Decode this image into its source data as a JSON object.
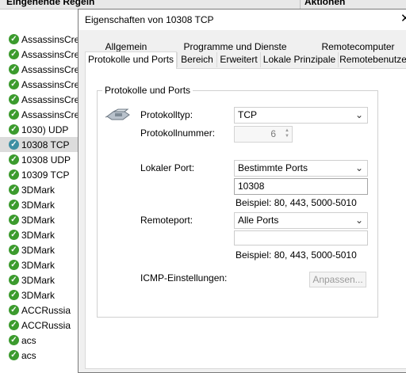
{
  "background": {
    "left_title": "Eingehende Regeln",
    "right_title": "Aktionen",
    "rules": [
      {
        "label": "AssassinsCre",
        "style": "green"
      },
      {
        "label": "AssassinsCre",
        "style": "green"
      },
      {
        "label": "AssassinsCre",
        "style": "green"
      },
      {
        "label": "AssassinsCre",
        "style": "green"
      },
      {
        "label": "AssassinsCre",
        "style": "green"
      },
      {
        "label": "AssassinsCre",
        "style": "green"
      },
      {
        "label": "1030) UDP",
        "style": "green"
      },
      {
        "label": "10308 TCP",
        "style": "alt",
        "selected": true
      },
      {
        "label": "10308 UDP",
        "style": "green"
      },
      {
        "label": "10309 TCP",
        "style": "green"
      },
      {
        "label": "3DMark",
        "style": "green"
      },
      {
        "label": "3DMark",
        "style": "green"
      },
      {
        "label": "3DMark",
        "style": "green"
      },
      {
        "label": "3DMark",
        "style": "green"
      },
      {
        "label": "3DMark",
        "style": "green"
      },
      {
        "label": "3DMark",
        "style": "green"
      },
      {
        "label": "3DMark",
        "style": "green"
      },
      {
        "label": "3DMark",
        "style": "green"
      },
      {
        "label": "ACCRussia",
        "style": "green"
      },
      {
        "label": "ACCRussia",
        "style": "green"
      },
      {
        "label": "acs",
        "style": "green"
      },
      {
        "label": "acs",
        "style": "green"
      }
    ]
  },
  "dialog": {
    "title": "Eigenschaften von 10308 TCP",
    "close_glyph": "✕",
    "tabs_row1": [
      "Allgemein",
      "Programme und Dienste",
      "Remotecomputer"
    ],
    "tabs_row2": [
      "Protokolle und Ports",
      "Bereich",
      "Erweitert",
      "Lokale Prinzipale",
      "Remotebenutzer"
    ],
    "active_tab": "Protokolle und Ports",
    "group_title": "Protokolle und Ports",
    "protocol_type_label": "Protokolltyp:",
    "protocol_type_value": "TCP",
    "protocol_number_label": "Protokollnummer:",
    "protocol_number_value": "6",
    "local_port_label": "Lokaler Port:",
    "local_port_mode": "Bestimmte Ports",
    "local_port_value": "10308",
    "local_port_example": "Beispiel: 80, 443, 5000-5010",
    "remote_port_label": "Remoteport:",
    "remote_port_mode": "Alle Ports",
    "remote_port_value": "",
    "remote_port_example": "Beispiel: 80, 443, 5000-5010",
    "icmp_label": "ICMP-Einstellungen:",
    "customize_button": "Anpassen..."
  },
  "icons": {
    "rule_icon": "check-shield-icon",
    "protocol_icon": "network-plug-icon",
    "chevron": "chevron-down-icon"
  }
}
